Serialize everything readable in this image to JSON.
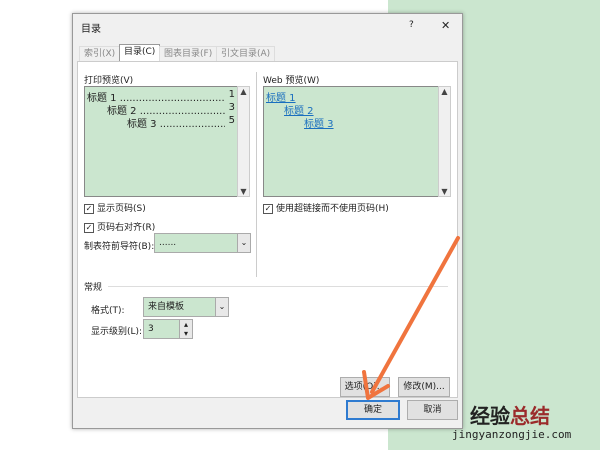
{
  "dialog": {
    "title": "目录",
    "help": "?",
    "close": "✕"
  },
  "tabs": [
    "索引(X)",
    "目录(C)",
    "图表目录(F)",
    "引文目录(A)"
  ],
  "print_preview": {
    "label": "打印预览(V)",
    "lines": [
      {
        "text": "标题 1",
        "page": "1"
      },
      {
        "text": "标题 2",
        "page": "3"
      },
      {
        "text": "标题 3",
        "page": "5"
      }
    ]
  },
  "web_preview": {
    "label": "Web 预览(W)",
    "links": [
      "标题 1",
      "标题 2",
      "标题 3"
    ]
  },
  "options": {
    "show_page_numbers": "显示页码(S)",
    "right_align": "页码右对齐(R)",
    "tab_leader_label": "制表符前导符(B):",
    "tab_leader_value": "......",
    "use_hyperlinks": "使用超链接而不使用页码(H)"
  },
  "general": {
    "heading": "常规",
    "format_label": "格式(T):",
    "format_value": "来自模板",
    "levels_label": "显示级别(L):",
    "levels_value": "3"
  },
  "buttons": {
    "options": "选项(O)...",
    "modify": "修改(M)...",
    "ok": "确定",
    "cancel": "取消"
  },
  "watermark": {
    "cn1": "经验",
    "cn2": "总结",
    "url": "jingyanzongjie.com"
  }
}
